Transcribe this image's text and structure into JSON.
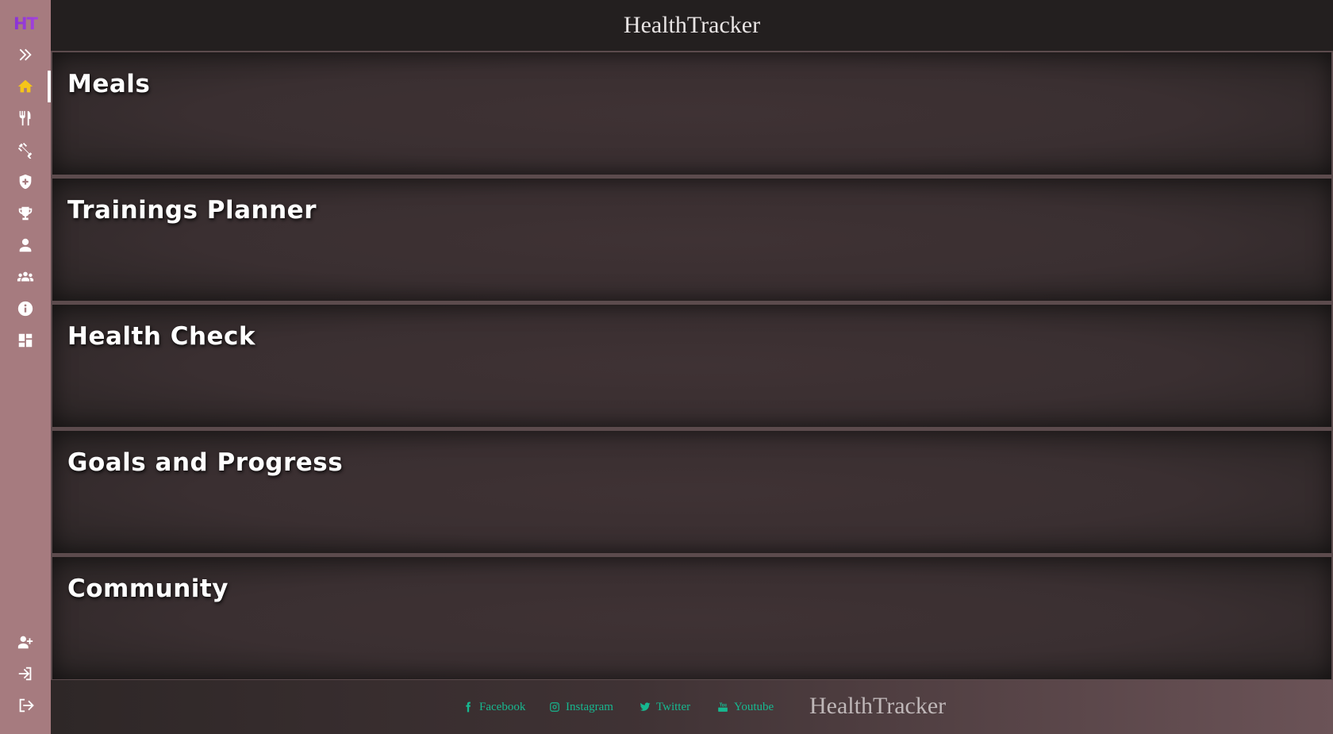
{
  "app": {
    "logo_text": "HT",
    "title": "HealthTracker"
  },
  "sidebar": {
    "items": [
      {
        "name": "expand",
        "icon": "double-chevron-right-icon"
      },
      {
        "name": "home",
        "icon": "home-icon",
        "active": true
      },
      {
        "name": "meals",
        "icon": "utensils-icon"
      },
      {
        "name": "trainings",
        "icon": "dumbbell-icon"
      },
      {
        "name": "health",
        "icon": "shield-plus-icon"
      },
      {
        "name": "goals",
        "icon": "trophy-icon"
      },
      {
        "name": "profile",
        "icon": "user-icon"
      },
      {
        "name": "community",
        "icon": "users-icon"
      },
      {
        "name": "info",
        "icon": "info-icon"
      },
      {
        "name": "dashboard",
        "icon": "dashboard-icon"
      }
    ],
    "bottom_items": [
      {
        "name": "register",
        "icon": "user-plus-icon"
      },
      {
        "name": "login",
        "icon": "sign-in-icon"
      },
      {
        "name": "logout",
        "icon": "sign-out-icon"
      }
    ]
  },
  "sections": [
    {
      "title": "Meals"
    },
    {
      "title": "Trainings Planner"
    },
    {
      "title": "Health Check"
    },
    {
      "title": "Goals and Progress"
    },
    {
      "title": "Community"
    }
  ],
  "footer": {
    "links": [
      {
        "label": "Facebook",
        "icon": "facebook-icon"
      },
      {
        "label": "Instagram",
        "icon": "instagram-icon"
      },
      {
        "label": "Twitter",
        "icon": "twitter-icon"
      },
      {
        "label": "Youtube",
        "icon": "youtube-icon"
      }
    ],
    "brand": "HealthTracker"
  },
  "colors": {
    "sidebar_bg": "#a67b7f",
    "active_icon": "#f5c518",
    "link_green": "#17b890",
    "logo_purple": "#7a2bd0"
  }
}
